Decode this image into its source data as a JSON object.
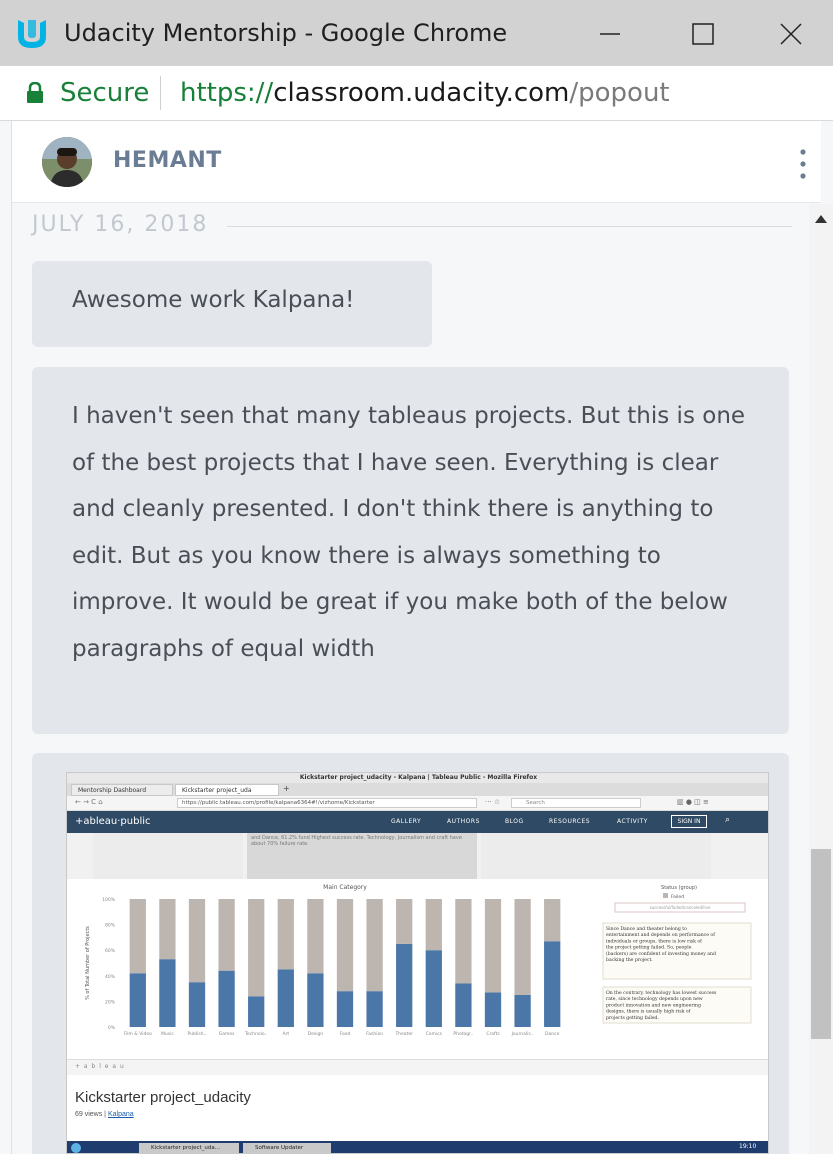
{
  "window": {
    "title": "Udacity Mentorship - Google Chrome",
    "logo_icon": "udacity-logo-icon",
    "buttons": [
      "minimize-icon",
      "maximize-icon",
      "close-icon"
    ]
  },
  "addressbar": {
    "secure_label": "Secure",
    "url_scheme": "https://",
    "url_host": "classroom.udacity.com",
    "url_path": "/popout",
    "secure_color": "#188038"
  },
  "header": {
    "username": "HEMANT",
    "menu_icon": "kebab-menu-icon"
  },
  "chat": {
    "date": "JULY 16, 2018",
    "messages": [
      {
        "text": "Awesome work Kalpana!"
      },
      {
        "text": "I haven't seen that many tableaus projects. But this is one of the best projects that I have seen. Everything is clear and cleanly presented. I don't think there is anything to edit. But as you know there is always something to improve. It would be great if you make both of the below paragraphs of equal width"
      }
    ]
  },
  "attachment": {
    "browser_title": "Kickstarter project_udacity - Kalpana | Tableau Public - Mozilla Firefox",
    "tabs": [
      "Mentorship Dashboard",
      "Kickstarter project_uda"
    ],
    "url": "https://public.tableau.com/profile/kalpana6364#!/vizhome/Kickstarter",
    "search_placeholder": "Search",
    "site_logo": "+ableau·public",
    "nav": [
      "GALLERY",
      "AUTHORS",
      "BLOG",
      "RESOURCES",
      "ACTIVITY"
    ],
    "signin": "SIGN IN",
    "story_text": "and Dance, 61.2% fund Highest success rate. Technology, Journalism and craft have about 70% failure rate.",
    "footer_brand": "+ a b l e a u",
    "viz_title": "Kickstarter project_udacity",
    "viz_views": "69 views",
    "viz_author": "Kalpana",
    "taskbar_items": [
      "Kickstarter project_uda...",
      "Software Updater"
    ],
    "clock": "19:10"
  },
  "chart_data": {
    "type": "bar",
    "title": "Main Category",
    "ylabel": "% of Total Number of Projects",
    "categories": [
      "Film & Video",
      "Music",
      "Publish..",
      "Games",
      "Technolo..",
      "Art",
      "Design",
      "Food",
      "Fashion",
      "Theater",
      "Comics",
      "Photogr..",
      "Crafts",
      "Journalis..",
      "Dance"
    ],
    "y_ticks": [
      "0%",
      "20%",
      "40%",
      "60%",
      "80%",
      "100%"
    ],
    "ylim": [
      0,
      100
    ],
    "series": [
      {
        "name": "Successful",
        "color": "#4a76a8",
        "values": [
          42,
          53,
          35,
          44,
          24,
          45,
          42,
          28,
          28,
          65,
          60,
          34,
          27,
          25,
          67
        ]
      },
      {
        "name": "Failed",
        "color": "#bdb6b0",
        "values": [
          58,
          47,
          65,
          56,
          76,
          55,
          58,
          72,
          72,
          35,
          40,
          66,
          73,
          75,
          33
        ]
      }
    ],
    "legend_title": "Status (group)",
    "legend_items": [
      "Failed"
    ],
    "filter_label": "successful/failed/canceled/live",
    "annotations": [
      "Since Dance and theater belong to entertainment and depends on performance of individuals or groups, there is low risk of the project getting failed. So, people (backers) are confident of investing money and backing the project.",
      "On the contrary, technology has lowest success rate, since technology depends upon new product innovation and new engineering designs, there is usually high risk of projects getting failed."
    ]
  }
}
